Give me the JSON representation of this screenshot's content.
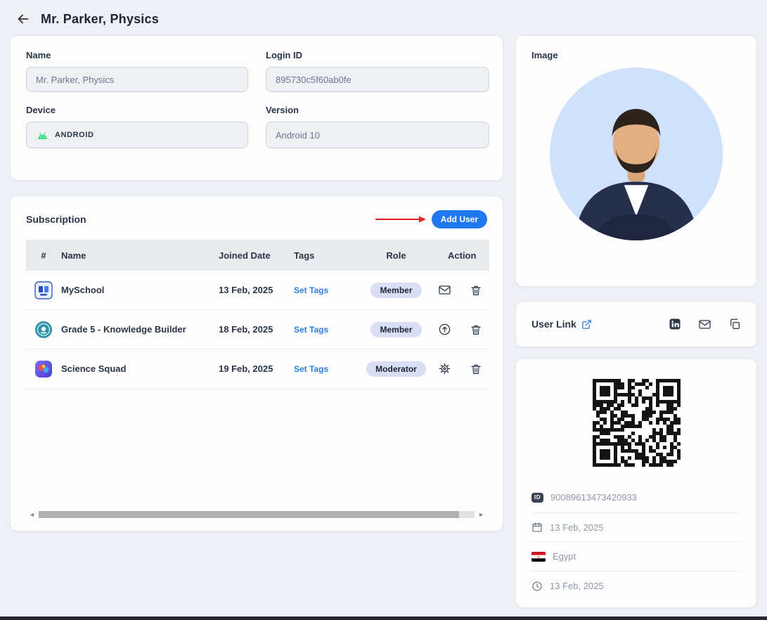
{
  "header": {
    "title": "Mr. Parker, Physics"
  },
  "form": {
    "name_label": "Name",
    "name_value": "Mr. Parker, Physics",
    "login_label": "Login ID",
    "login_value": "895730c5f60ab0fe",
    "device_label": "Device",
    "device_value": "ANDROID",
    "version_label": "Version",
    "version_value": "Android 10"
  },
  "subscription": {
    "title": "Subscription",
    "add_user_label": "Add User",
    "headers": {
      "num": "#",
      "name": "Name",
      "joined": "Joined Date",
      "tags": "Tags",
      "role": "Role",
      "action": "Action"
    },
    "rows": [
      {
        "name": "MySchool",
        "joined": "13 Feb, 2025",
        "tags_link": "Set Tags",
        "role": "Member"
      },
      {
        "name": "Grade 5 - Knowledge Builder",
        "joined": "18 Feb, 2025",
        "tags_link": "Set Tags",
        "role": "Member"
      },
      {
        "name": "Science Squad",
        "joined": "19 Feb, 2025",
        "tags_link": "Set Tags",
        "role": "Moderator"
      }
    ]
  },
  "image_card": {
    "title": "Image"
  },
  "user_link": {
    "title": "User Link"
  },
  "details": {
    "id_badge": "ID",
    "user_id": "90089613473420933",
    "joined_date": "13 Feb, 2025",
    "country": "Egypt",
    "updated_date": "13 Feb, 2025"
  },
  "icons": [
    "arrow-left-icon",
    "android-icon",
    "mail-icon",
    "trash-icon",
    "upload-circle-icon",
    "gear-icon",
    "external-link-icon",
    "linkedin-icon",
    "copy-icon",
    "id-icon",
    "calendar-icon",
    "egypt-flag-icon",
    "clock-icon",
    "qr-code",
    "red-annotation-arrow"
  ],
  "colors": {
    "accent_blue": "#1f78f0",
    "link_blue": "#2a7de1",
    "badge_bg": "#d9def5",
    "arrow_red": "#e02424",
    "page_bg": "#eef0f6"
  }
}
